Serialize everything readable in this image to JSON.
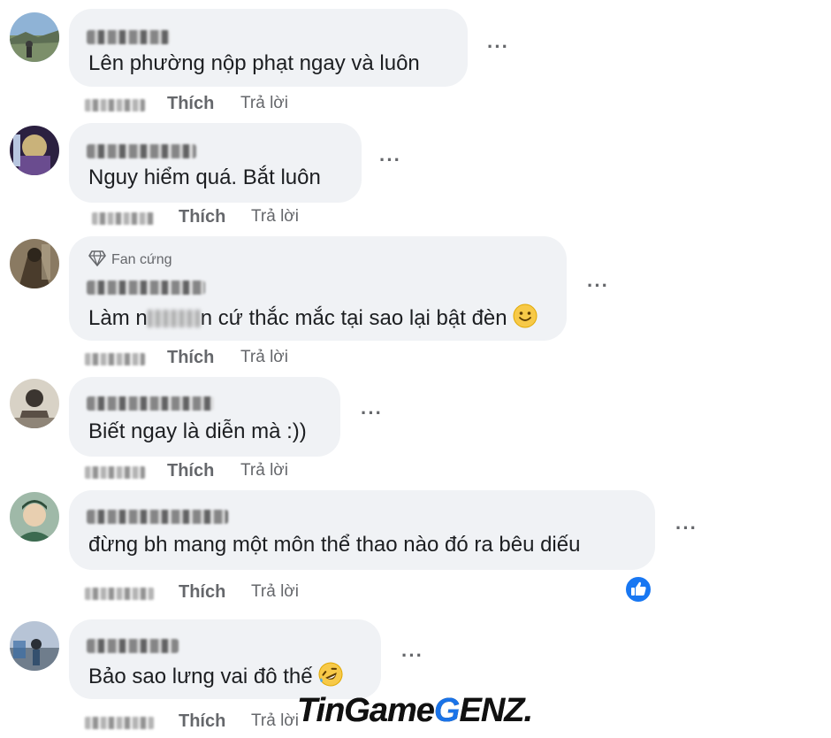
{
  "comments": [
    {
      "text": "Lên phường nộp phạt ngay và luôn",
      "like_label": "Thích",
      "reply_label": "Trả lời"
    },
    {
      "text": "Nguy hiểm quá. Bắt luôn",
      "like_label": "Thích",
      "reply_label": "Trả lời"
    },
    {
      "badge": "Fan cứng",
      "text_before": "Làm n",
      "text_after": "n cứ thắc mắc tại sao lại bật đèn",
      "like_label": "Thích",
      "reply_label": "Trả lời"
    },
    {
      "text": "Biết ngay là diễn mà :))",
      "like_label": "Thích",
      "reply_label": "Trả lời"
    },
    {
      "text": "đừng bh mang một môn thể thao nào đó ra bêu diếu",
      "like_label": "Thích",
      "reply_label": "Trả lời"
    },
    {
      "text": "Bảo sao lưng vai đô thế",
      "like_label": "Thích",
      "reply_label": "Trả lời"
    }
  ],
  "more_label": "···",
  "watermark": {
    "part1": "TinGame",
    "part2": "G",
    "part3": "ENZ."
  },
  "colors": {
    "bubble": "#f0f2f5",
    "meta": "#65676b",
    "like_blue": "#1877f2"
  }
}
